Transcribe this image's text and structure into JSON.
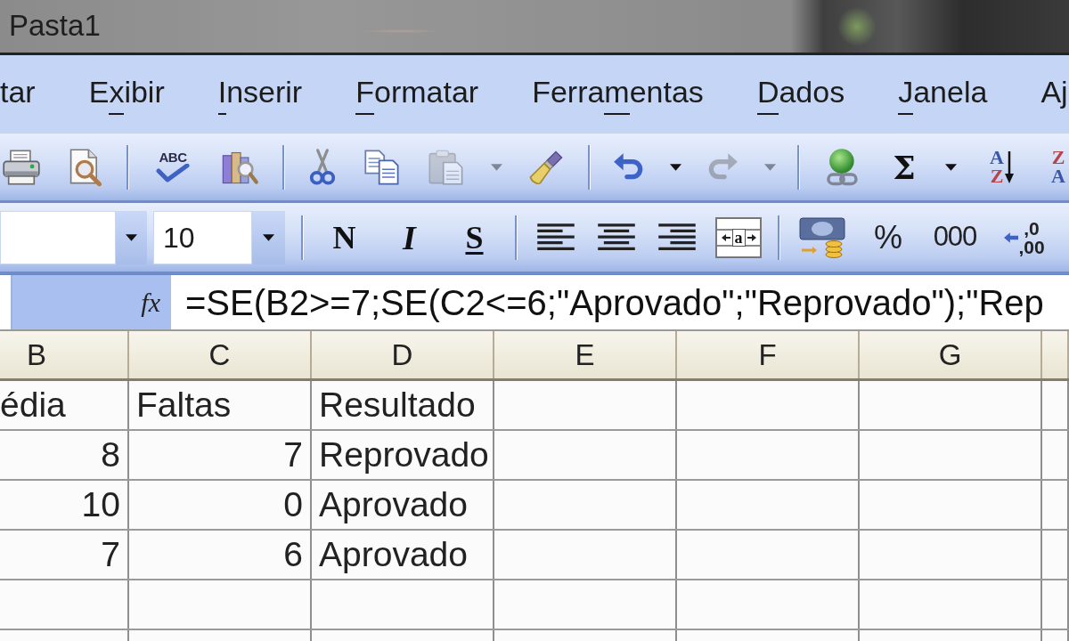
{
  "window": {
    "title": "Pasta1"
  },
  "menu_bar": [
    {
      "segments": [
        {
          "text": "tar",
          "underlined": false
        }
      ]
    },
    {
      "segments": [
        {
          "text": "E",
          "underlined": false
        },
        {
          "text": "x",
          "underlined": true
        },
        {
          "text": "ibir",
          "underlined": false
        }
      ]
    },
    {
      "segments": [
        {
          "text": "I",
          "underlined": true
        },
        {
          "text": "nserir",
          "underlined": false
        }
      ]
    },
    {
      "segments": [
        {
          "text": "F",
          "underlined": true
        },
        {
          "text": "ormatar",
          "underlined": false
        }
      ]
    },
    {
      "segments": [
        {
          "text": "Ferra",
          "underlined": false
        },
        {
          "text": "m",
          "underlined": true
        },
        {
          "text": "entas",
          "underlined": false
        }
      ]
    },
    {
      "segments": [
        {
          "text": "D",
          "underlined": true
        },
        {
          "text": "ados",
          "underlined": false
        }
      ]
    },
    {
      "segments": [
        {
          "text": "J",
          "underlined": true
        },
        {
          "text": "anela",
          "underlined": false
        }
      ]
    },
    {
      "segments": [
        {
          "text": "Aj",
          "underlined": false
        }
      ]
    }
  ],
  "standard_toolbar": [
    {
      "kind": "button",
      "disabled": false
    },
    {
      "kind": "button",
      "disabled": false
    },
    {
      "kind": "separator"
    },
    {
      "kind": "button",
      "disabled": false,
      "text": "ABC"
    },
    {
      "kind": "button",
      "disabled": false
    },
    {
      "kind": "separator"
    },
    {
      "kind": "button",
      "disabled": false
    },
    {
      "kind": "button",
      "disabled": false
    },
    {
      "kind": "split",
      "disabled": true
    },
    {
      "kind": "button",
      "disabled": false
    },
    {
      "kind": "separator"
    },
    {
      "kind": "split",
      "disabled": false
    },
    {
      "kind": "split",
      "disabled": true
    },
    {
      "kind": "separator"
    },
    {
      "kind": "button",
      "disabled": false
    },
    {
      "kind": "split",
      "disabled": false,
      "text": "Σ"
    },
    {
      "kind": "button",
      "disabled": false,
      "lines": [
        "A",
        "Z"
      ]
    },
    {
      "kind": "button",
      "disabled": false,
      "lines": [
        "Z",
        "A"
      ]
    }
  ],
  "formatting_toolbar": [
    {
      "kind": "combo"
    },
    {
      "kind": "combo",
      "value": "10"
    },
    {
      "kind": "separator"
    },
    {
      "kind": "toggle",
      "text": "N",
      "pressed": false
    },
    {
      "kind": "toggle",
      "text": "I",
      "pressed": false
    },
    {
      "kind": "toggle",
      "text": "S",
      "pressed": false
    },
    {
      "kind": "separator"
    },
    {
      "kind": "toggle",
      "pressed": false
    },
    {
      "kind": "toggle",
      "pressed": false
    },
    {
      "kind": "toggle",
      "pressed": false
    },
    {
      "kind": "toggle",
      "text": "a",
      "pressed": false
    },
    {
      "kind": "separator"
    },
    {
      "kind": "button"
    },
    {
      "kind": "button",
      "text": "%"
    },
    {
      "kind": "button",
      "text": "000"
    },
    {
      "kind": "button",
      "lines": [
        ",0",
        ",00"
      ]
    }
  ],
  "formula_bar": {
    "function_symbol": "fx",
    "formula": "=SE(B2>=7;SE(C2<=6;\"Aprovado\";\"Reprovado\");\"Rep"
  },
  "sheet": {
    "columns": [
      "B",
      "C",
      "D",
      "E",
      "F",
      "G"
    ],
    "rows": [
      {
        "cells": [
          {
            "text": "édia",
            "kind": "text"
          },
          {
            "text": "Faltas",
            "kind": "text"
          },
          {
            "text": "Resultado",
            "kind": "text"
          }
        ]
      },
      {
        "cells": [
          {
            "text": "8",
            "kind": "number"
          },
          {
            "text": "7",
            "kind": "number"
          },
          {
            "text": "Reprovado",
            "kind": "text"
          }
        ]
      },
      {
        "cells": [
          {
            "text": "10",
            "kind": "number"
          },
          {
            "text": "0",
            "kind": "number"
          },
          {
            "text": "Aprovado",
            "kind": "text"
          }
        ]
      },
      {
        "cells": [
          {
            "text": "7",
            "kind": "number"
          },
          {
            "text": "6",
            "kind": "number"
          },
          {
            "text": "Aprovado",
            "kind": "text"
          }
        ]
      }
    ]
  }
}
